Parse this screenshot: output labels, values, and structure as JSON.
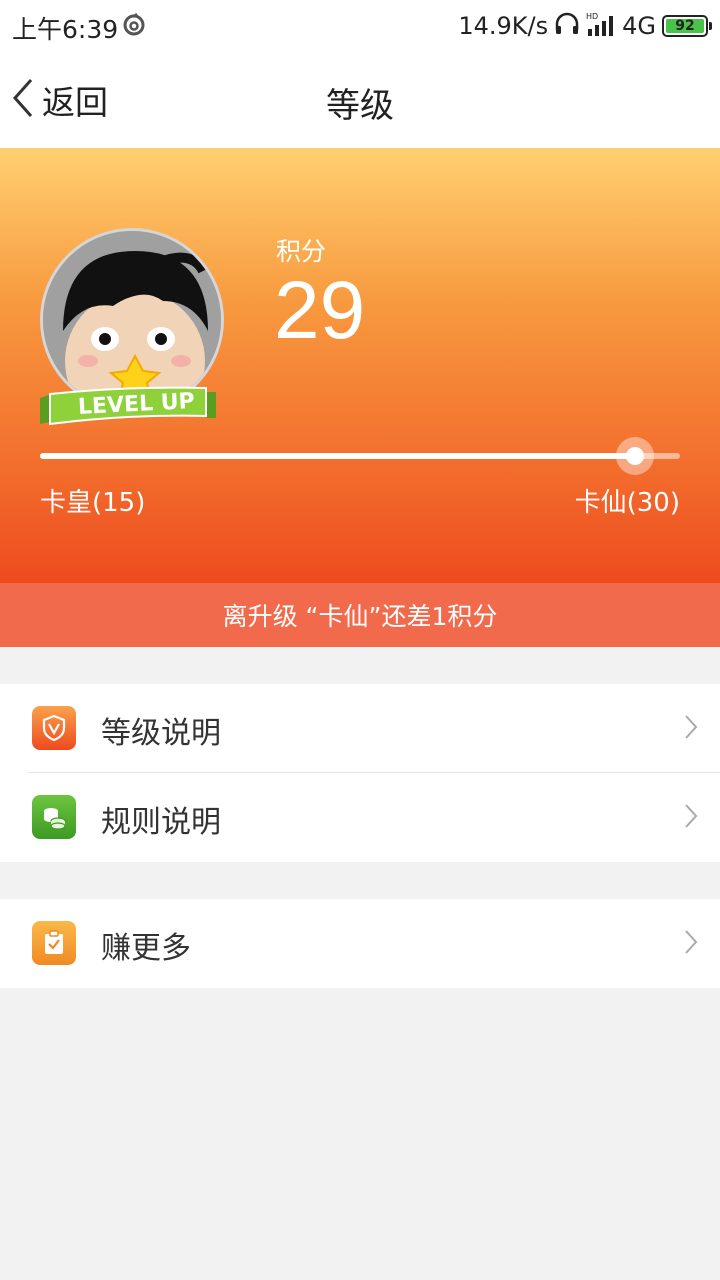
{
  "status_bar": {
    "time": "上午6:39",
    "speed": "14.9K/s",
    "network": "4G",
    "battery": "92"
  },
  "nav": {
    "back_label": "返回",
    "title": "等级"
  },
  "hero": {
    "score_label": "积分",
    "score_value": "29",
    "badge_text": "LEVEL UP",
    "progress_fraction": 0.93,
    "level_current": "卡皇(15)",
    "level_next": "卡仙(30)"
  },
  "hint": {
    "text": "离升级 “卡仙”还差1积分"
  },
  "menu": {
    "items": [
      {
        "label": "等级说明",
        "icon": "shield-v-icon",
        "color": "#f0572a"
      },
      {
        "label": "规则说明",
        "icon": "coins-icon",
        "color": "#4aa52c"
      },
      {
        "label": "赚更多",
        "icon": "clipboard-check-icon",
        "color": "#f69a2e"
      }
    ]
  }
}
